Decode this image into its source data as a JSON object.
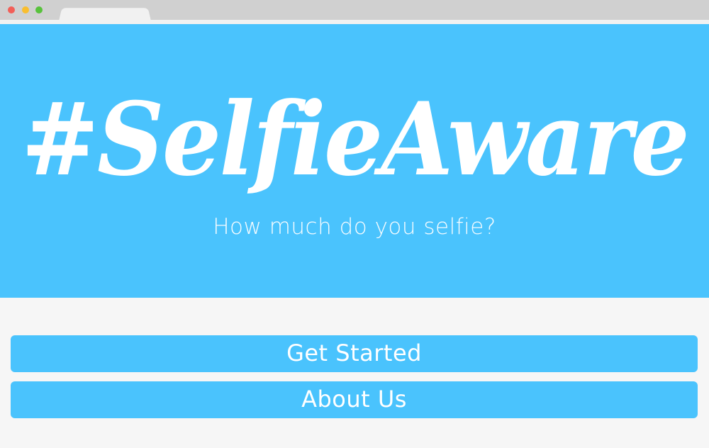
{
  "window": {
    "controls": [
      "close",
      "minimize",
      "zoom"
    ]
  },
  "hero": {
    "brand": "#SelfieAware",
    "subtitle": "How much do you selfie?",
    "background_color": "#4ac3fd"
  },
  "actions": {
    "get_started_label": "Get Started",
    "about_us_label": "About Us"
  }
}
